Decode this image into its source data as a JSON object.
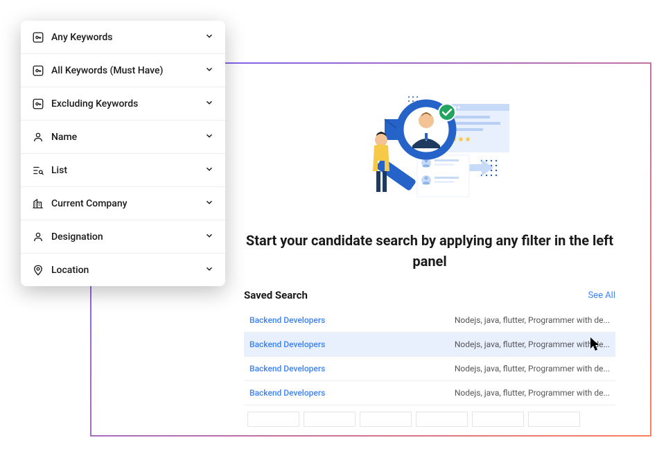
{
  "heading": "Start your candidate search by applying any filter in the left panel",
  "savedSearch": {
    "title": "Saved Search",
    "seeAll": "See All",
    "rows": [
      {
        "name": "Backend Developers",
        "desc": "Nodejs, java, flutter, Programmer with de..."
      },
      {
        "name": "Backend Developers",
        "desc": "Nodejs, java, flutter, Programmer with de..."
      },
      {
        "name": "Backend Developers",
        "desc": "Nodejs, java, flutter, Programmer with de..."
      },
      {
        "name": "Backend Developers",
        "desc": "Nodejs, java, flutter, Programmer with de..."
      }
    ]
  },
  "filters": {
    "items": [
      {
        "label": "Any Keywords"
      },
      {
        "label": "All Keywords (Must Have)"
      },
      {
        "label": "Excluding Keywords"
      },
      {
        "label": "Name"
      },
      {
        "label": "List"
      },
      {
        "label": "Current Company"
      },
      {
        "label": "Designation"
      },
      {
        "label": "Location"
      }
    ]
  }
}
